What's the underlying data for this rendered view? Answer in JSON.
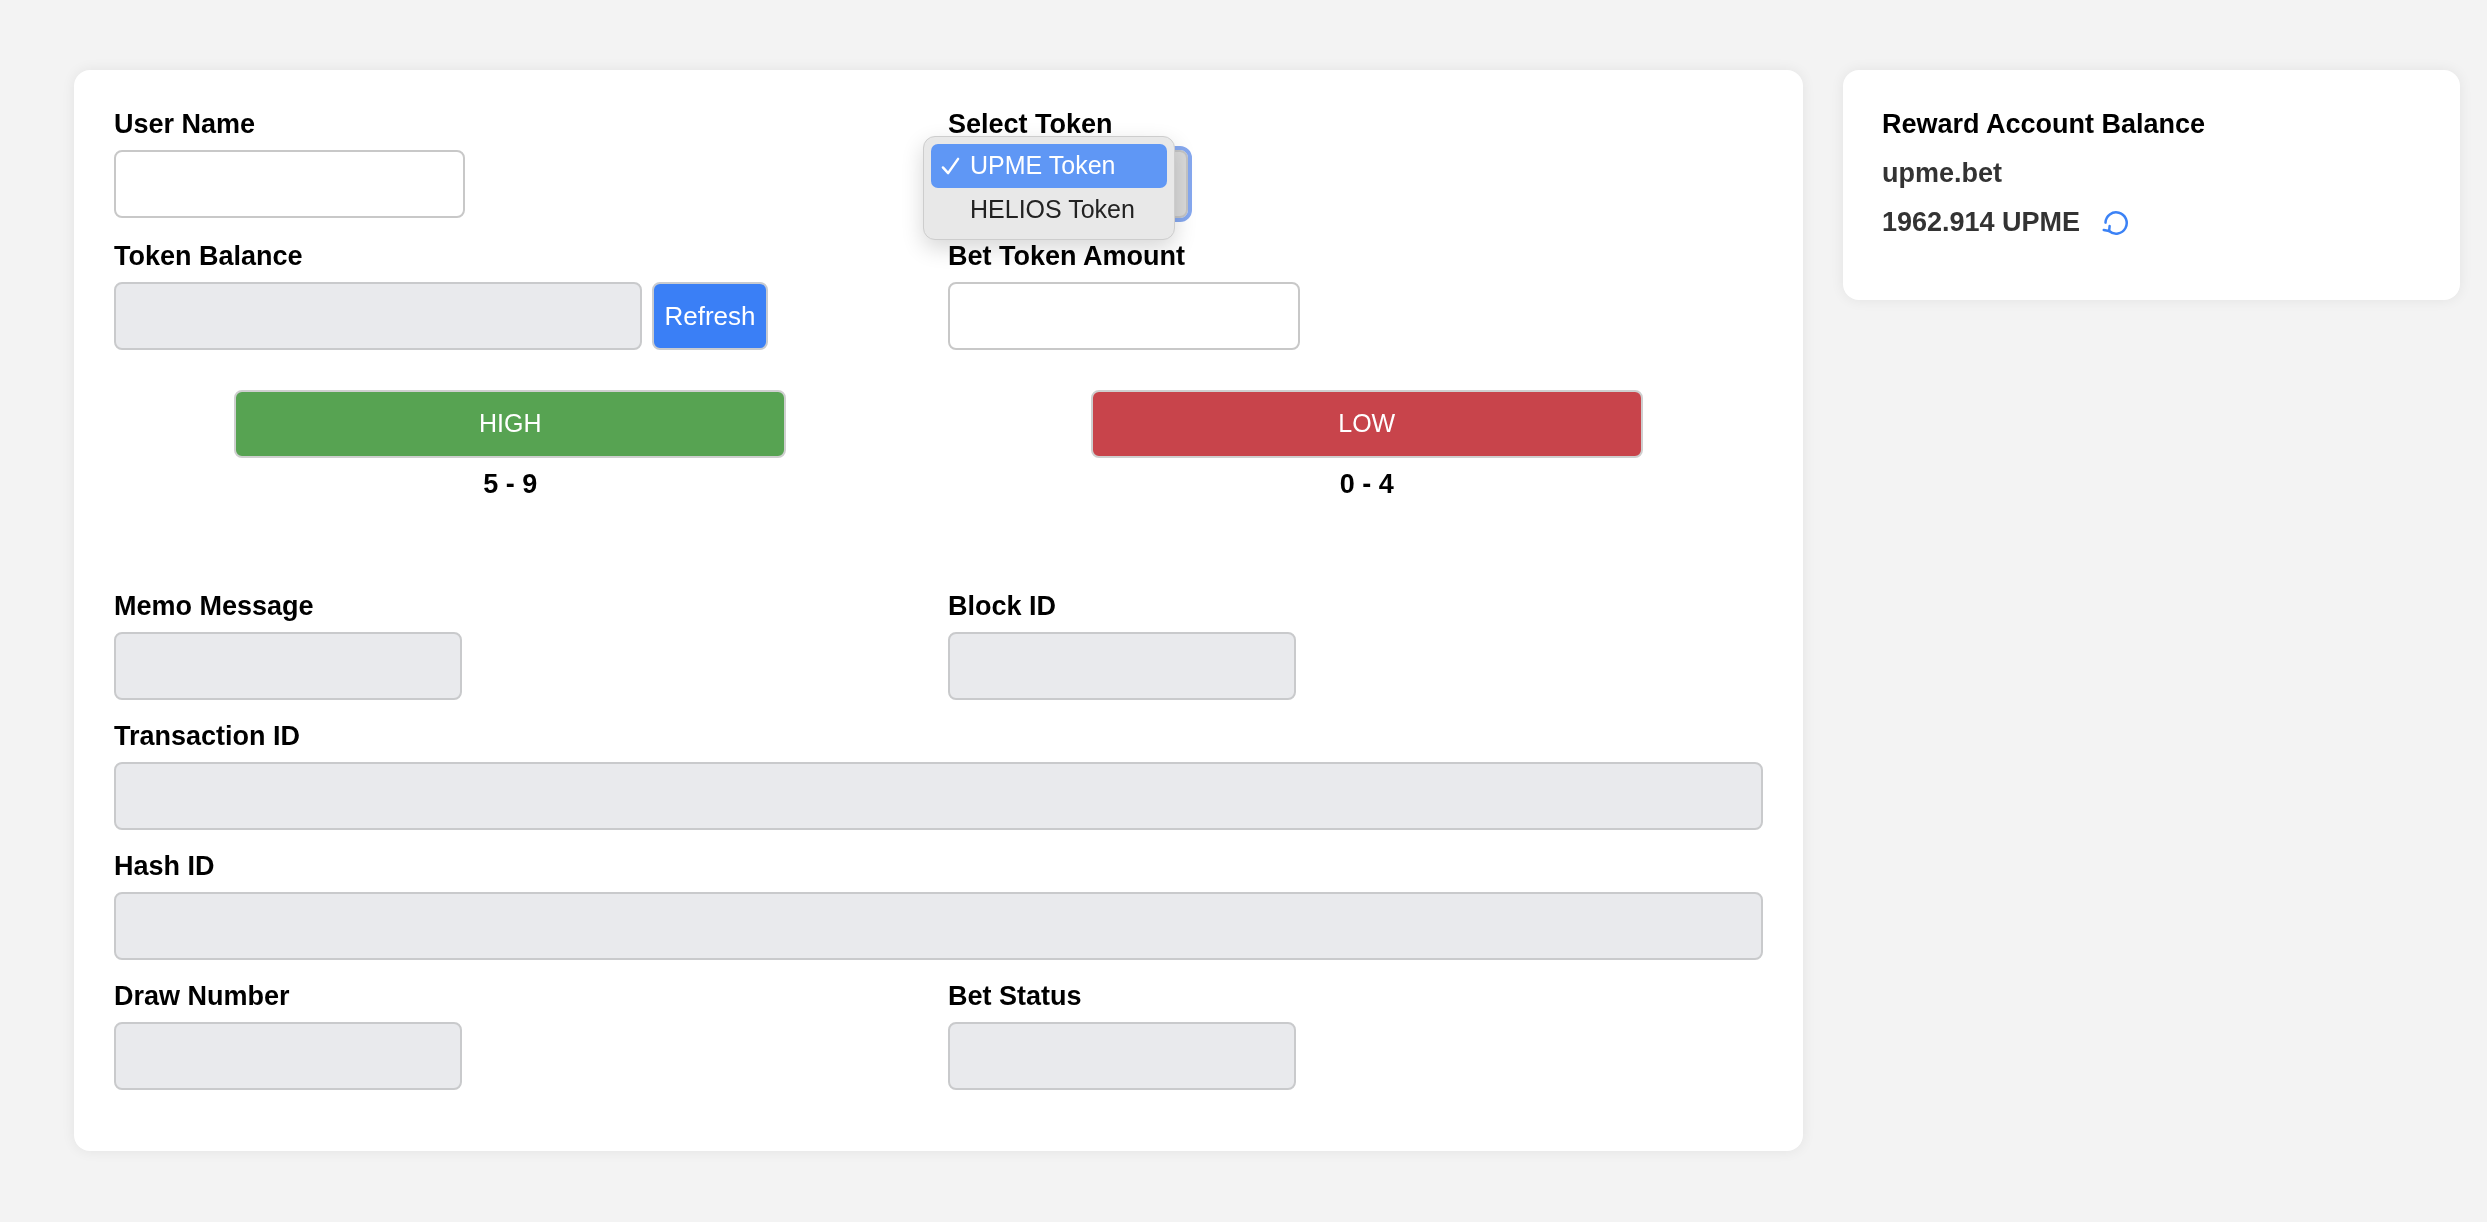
{
  "main_form": {
    "user_name": {
      "label": "User Name",
      "disabled": false
    },
    "select_token": {
      "label": "Select Token",
      "expanded": true,
      "options": [
        {
          "label": "UPME Token",
          "selected": true
        },
        {
          "label": "HELIOS Token",
          "selected": false
        }
      ]
    },
    "token_balance": {
      "label": "Token Balance",
      "disabled": true,
      "button": "Refresh"
    },
    "bet_token_amount": {
      "label": "Bet Token Amount",
      "disabled": false
    },
    "bets": [
      {
        "label": "HIGH",
        "range": "5 - 9",
        "color": "#57a352"
      },
      {
        "label": "LOW",
        "range": "0 - 4",
        "color": "#c8444b"
      }
    ],
    "result_rows": [
      [
        {
          "label": "Memo Message",
          "disabled": true
        },
        {
          "label": "Block ID",
          "disabled": true
        }
      ],
      [
        {
          "label": "Transaction ID",
          "disabled": true
        }
      ],
      [
        {
          "label": "Hash ID",
          "disabled": true
        }
      ],
      [
        {
          "label": "Draw Number",
          "disabled": true
        },
        {
          "label": "Bet Status",
          "disabled": true
        }
      ]
    ]
  },
  "reward_card": {
    "title": "Reward Account Balance",
    "account": "upme.bet",
    "balance": "1962.914 UPME"
  }
}
